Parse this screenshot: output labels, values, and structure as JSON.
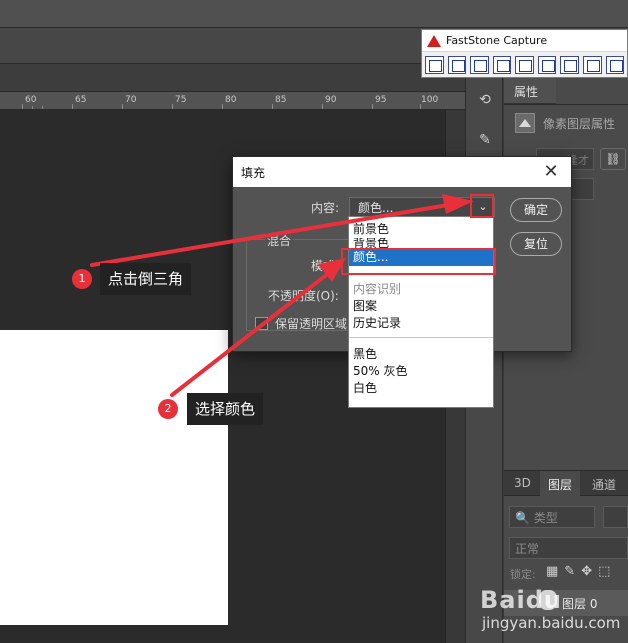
{
  "ruler_ticks": [
    "60",
    "65",
    "70",
    "75",
    "80",
    "85",
    "90",
    "95",
    "100"
  ],
  "faststone": {
    "title": "FastStone Capture"
  },
  "fill_dialog": {
    "title": "填充",
    "content_label": "内容:",
    "content_value": "颜色...",
    "blend_group_label": "混合",
    "mode_label": "模式:",
    "opacity_label": "不透明度(O):",
    "preserve_label": "保留透明区域",
    "ok_label": "确定",
    "reset_label": "复位"
  },
  "dropdown_options": {
    "group1": [
      "前景色",
      "背景色",
      "颜色..."
    ],
    "selected": "颜色...",
    "group2": [
      "内容识别",
      "图案",
      "历史记录"
    ],
    "group3": [
      "黑色",
      "50% 灰色",
      "白色"
    ]
  },
  "annotations": {
    "step1_number": "1",
    "step1_text": "点击倒三角",
    "step2_number": "2",
    "step2_text": "选择颜色"
  },
  "properties_panel": {
    "tab_label": "属性",
    "subtitle": "像素图层属性",
    "field_partial": "逢才"
  },
  "layers_panel": {
    "tabs": [
      "3D",
      "图层",
      "通道"
    ],
    "active_tab": "图层",
    "search_placeholder": "类型",
    "blend_mode": "正常",
    "lock_label": "锁定:",
    "layer_name": "图层 0"
  },
  "watermark": {
    "brand": "Baidu",
    "url": "jingyan.baidu.com"
  },
  "colors": {
    "highlight_blue": "#1e73c8",
    "annotation_red": "#e8303a",
    "callout_bg": "#222222"
  }
}
